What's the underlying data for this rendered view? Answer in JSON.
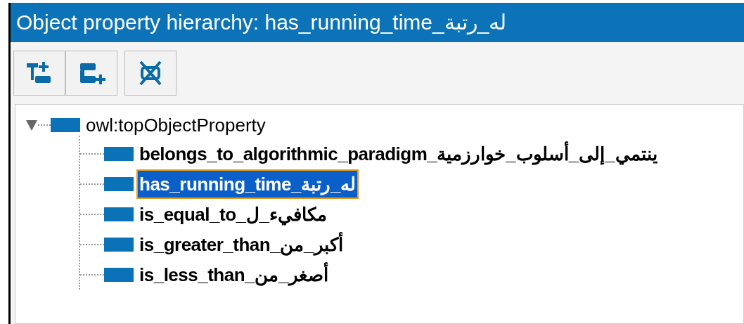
{
  "window": {
    "title": "Object property hierarchy: has_running_time_له_رتبة"
  },
  "toolbar": [
    {
      "kind": "add-sub"
    },
    {
      "kind": "add-sibling"
    },
    {
      "kind": "delete"
    }
  ],
  "tree": {
    "label": "owl:topObjectProperty",
    "expanded": true,
    "selected": false,
    "children": [
      {
        "label": "belongs_to_algorithmic_paradigm_ينتمي_إلى_أسلوب_خوارزمية",
        "selected": false
      },
      {
        "label": "has_running_time_له_رتبة",
        "selected": true
      },
      {
        "label": "is_equal_to_مكافيء_ل",
        "selected": false
      },
      {
        "label": "is_greater_than_أكبر_من",
        "selected": false
      },
      {
        "label": "is_less_than_أصغر_من",
        "selected": false
      }
    ]
  }
}
